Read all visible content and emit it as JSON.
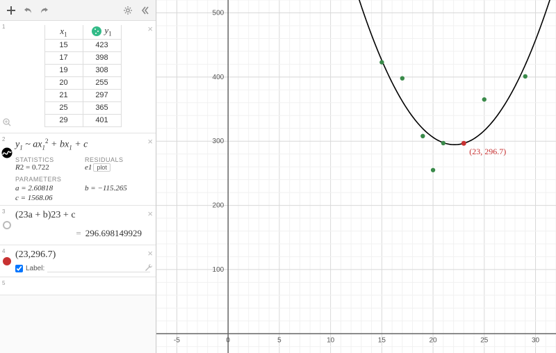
{
  "chart_data": {
    "type": "scatter",
    "title": "",
    "xlabel": "",
    "ylabel": "",
    "xlim": [
      -7,
      32
    ],
    "ylim": [
      -30,
      520
    ],
    "series": [
      {
        "name": "data points",
        "x": [
          15,
          17,
          19,
          20,
          21,
          25,
          29
        ],
        "y": [
          423,
          398,
          308,
          255,
          297,
          365,
          401
        ],
        "style": "points",
        "color": "#3a8a4a"
      },
      {
        "name": "quadratic fit y = 2.60818 x^2 - 115.265 x + 1568.06",
        "style": "curve",
        "color": "#000"
      },
      {
        "name": "marker",
        "x": [
          23
        ],
        "y": [
          296.7
        ],
        "style": "point",
        "color": "#c83232",
        "label": "(23, 296.7)"
      }
    ]
  },
  "table": {
    "col_x": "x",
    "col_x_sub": "1",
    "col_y": "y",
    "col_y_sub": "1",
    "rows": [
      {
        "x": "15",
        "y": "423"
      },
      {
        "x": "17",
        "y": "398"
      },
      {
        "x": "19",
        "y": "308"
      },
      {
        "x": "20",
        "y": "255"
      },
      {
        "x": "21",
        "y": "297"
      },
      {
        "x": "25",
        "y": "365"
      },
      {
        "x": "29",
        "y": "401"
      }
    ]
  },
  "regression": {
    "expr_html": "y<sub>1</sub> ~ a x<sub>1</sub><sup>2</sup> + b x<sub>1</sub> + c",
    "stats_label": "STATISTICS",
    "resid_label": "RESIDUALS",
    "r2_label": "R",
    "r2_sup": "2",
    "r2_eq": "= 0.722",
    "e1_label": "e",
    "e1_sub": "1",
    "plot_btn": "plot",
    "param_label": "PARAMETERS",
    "a": "a = 2.60818",
    "b": "b = −115.265",
    "c": "c = 1568.06"
  },
  "eval": {
    "idx": "3",
    "expr": "(23a + b)23 + c",
    "eq": "=",
    "value": "296.698149929"
  },
  "point": {
    "idx": "4",
    "expr": "(23,296.7)",
    "label_text": "Label:"
  },
  "marker_label": "(23, 296.7)",
  "axis_ticks": {
    "x": [
      -5,
      0,
      5,
      10,
      15,
      20,
      25,
      30
    ],
    "y": [
      100,
      200,
      300,
      400,
      500
    ]
  }
}
